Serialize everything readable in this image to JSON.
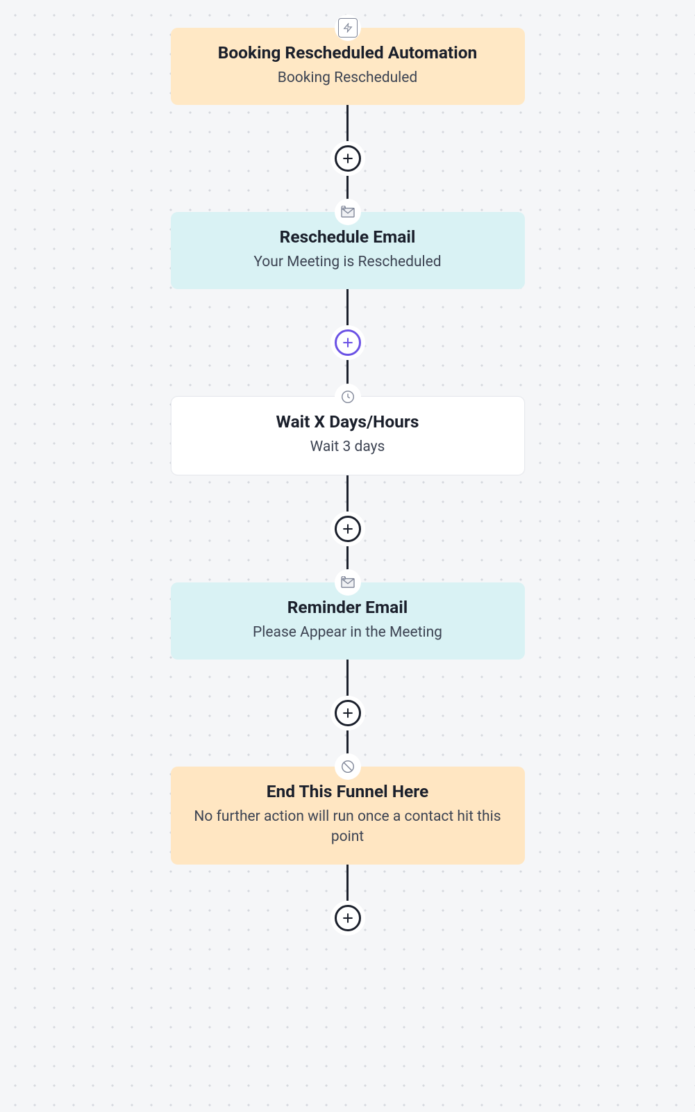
{
  "nodes": [
    {
      "title": "Booking Rescheduled Automation",
      "subtitle": "Booking Rescheduled"
    },
    {
      "title": "Reschedule Email",
      "subtitle": "Your Meeting is Rescheduled"
    },
    {
      "title": "Wait X Days/Hours",
      "subtitle": "Wait 3 days"
    },
    {
      "title": "Reminder Email",
      "subtitle": "Please Appear in the Meeting"
    },
    {
      "title": "End This Funnel Here",
      "subtitle": "No further action will run once a contact hit this point"
    }
  ]
}
